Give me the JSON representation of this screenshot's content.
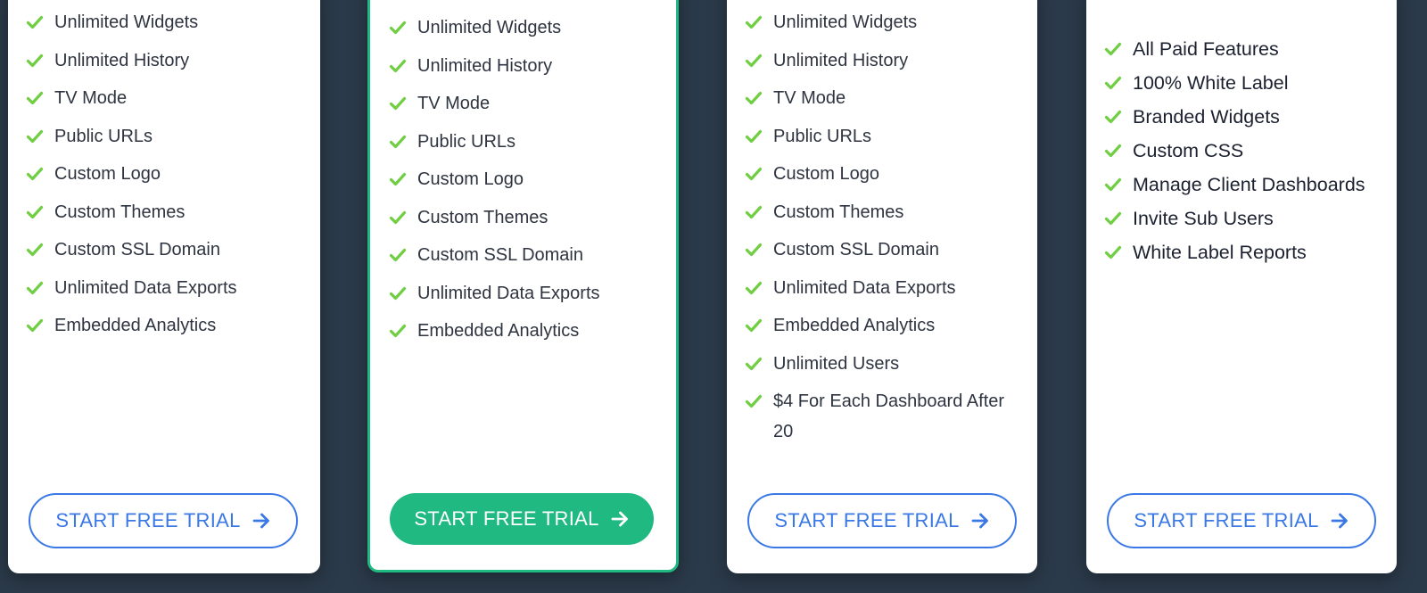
{
  "colors": {
    "background": "#2b3a4a",
    "check": "#6fce42",
    "button_blue": "#3a78e6",
    "featured_green": "#20b982"
  },
  "cta_label": "START FREE TRIAL",
  "plans": [
    {
      "features": [
        "Unlimited Widgets",
        "Unlimited History",
        "TV Mode",
        "Public URLs",
        "Custom Logo",
        "Custom Themes",
        "Custom SSL Domain",
        "Unlimited Data Exports",
        "Embedded Analytics"
      ]
    },
    {
      "features": [
        "Unlimited Widgets",
        "Unlimited History",
        "TV Mode",
        "Public URLs",
        "Custom Logo",
        "Custom Themes",
        "Custom SSL Domain",
        "Unlimited Data Exports",
        "Embedded Analytics"
      ]
    },
    {
      "features": [
        "Unlimited Widgets",
        "Unlimited History",
        "TV Mode",
        "Public URLs",
        "Custom Logo",
        "Custom Themes",
        "Custom SSL Domain",
        "Unlimited Data Exports",
        "Embedded Analytics",
        "Unlimited Users",
        "$4 For Each Dashboard After 20"
      ]
    },
    {
      "features": [
        "All Paid Features",
        "100% White Label",
        "Branded Widgets",
        "Custom CSS",
        "Manage Client Dashboards",
        "Invite Sub Users",
        "White Label Reports"
      ]
    }
  ]
}
